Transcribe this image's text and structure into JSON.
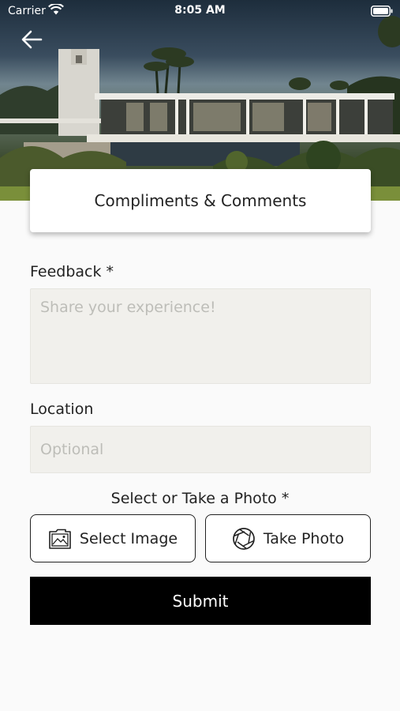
{
  "status_bar": {
    "carrier": "Carrier",
    "time": "8:05 AM"
  },
  "nav": {
    "back_icon": "arrow-left-icon"
  },
  "page": {
    "title": "Compliments & Comments"
  },
  "form": {
    "feedback": {
      "label": "Feedback *",
      "placeholder": "Share your experience!",
      "value": ""
    },
    "location": {
      "label": "Location",
      "placeholder": "Optional",
      "value": ""
    },
    "photo": {
      "label": "Select or Take a Photo *",
      "select_label": "Select Image",
      "select_icon": "image-icon",
      "take_label": "Take Photo",
      "take_icon": "camera-aperture-icon"
    },
    "submit_label": "Submit"
  },
  "colors": {
    "accent": "#000000",
    "field_bg": "#f1f0ec",
    "page_bg": "#fafafa"
  }
}
